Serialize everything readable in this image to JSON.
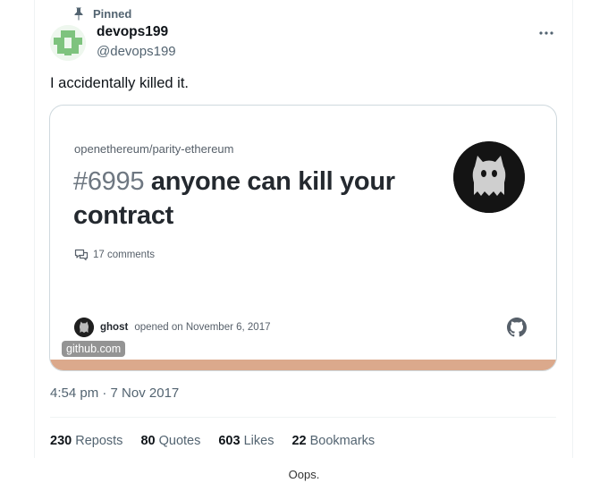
{
  "pinned_label": "Pinned",
  "author": {
    "display_name": "devops199",
    "handle": "@devops199"
  },
  "tweet": {
    "text": "I accidentally killed it.",
    "timestamp": "4:54 pm · 7 Nov 2017"
  },
  "card": {
    "repo": "openethereum/parity-ethereum",
    "issue_number": "#6995",
    "issue_title": "anyone can kill your contract",
    "comments": "17 comments",
    "footer_user": "ghost",
    "footer_text": "opened on November 6, 2017",
    "domain": "github.com",
    "accent_color": "#dba98c"
  },
  "stats": {
    "reposts_count": "230",
    "reposts_label": "Reposts",
    "quotes_count": "80",
    "quotes_label": "Quotes",
    "likes_count": "603",
    "likes_label": "Likes",
    "bookmarks_count": "22",
    "bookmarks_label": "Bookmarks"
  },
  "caption": "Oops.",
  "icons": [
    "pin-icon",
    "more-icon",
    "comment-icon",
    "github-icon"
  ]
}
